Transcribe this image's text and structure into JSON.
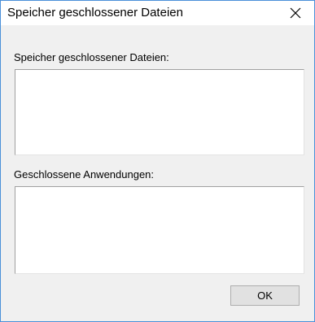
{
  "window": {
    "title": "Speicher geschlossener Dateien",
    "close_icon": "close-icon"
  },
  "sections": {
    "closed_files_label": "Speicher geschlossener Dateien:",
    "closed_apps_label": "Geschlossene Anwendungen:"
  },
  "buttons": {
    "ok_label": "OK"
  },
  "colors": {
    "window_border": "#4a90d9",
    "dialog_background": "#f0f0f0"
  }
}
